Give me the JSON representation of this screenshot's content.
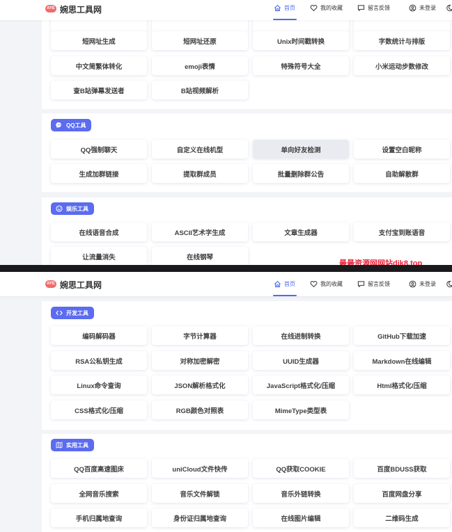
{
  "brand": {
    "logo_text": "AYE",
    "name": "婉思工具网"
  },
  "nav": [
    {
      "label": "首页",
      "icon": "home-icon",
      "active": true
    },
    {
      "label": "我的收藏",
      "icon": "heart-icon",
      "active": false
    },
    {
      "label": "留言反馈",
      "icon": "chat-icon",
      "active": false
    },
    {
      "label": "未登录",
      "icon": "user-icon",
      "active": false
    }
  ],
  "accent_color": "#5b6cf0",
  "screenshot1": {
    "misc_rows": [
      [
        "短网址生成",
        "短网址还原",
        "Unix时间戳转换",
        "字数统计与排版"
      ],
      [
        "中文简繁体转化",
        "emoji表情",
        "特殊符号大全",
        "小米运动步数修改"
      ],
      [
        "查B站弹幕发送者",
        "B站视频解析"
      ]
    ],
    "qq_section": {
      "title": "QQ工具",
      "icon": "chat-bubble-icon",
      "rows": [
        [
          "QQ强制聊天",
          "自定义在线机型",
          "单向好友检测",
          "设置空白昵称"
        ],
        [
          "生成加群链接",
          "提取群成员",
          "批量删除群公告",
          "自助解散群"
        ]
      ]
    },
    "fun_section": {
      "title": "娱乐工具",
      "icon": "smile-icon",
      "rows": [
        [
          "在线语音合成",
          "ASCII艺术字生成",
          "文章生成器",
          "支付宝到账语音"
        ],
        [
          "让流量消失",
          "在线钢琴"
        ]
      ]
    },
    "watermark": "最最资源网网站dik8.top"
  },
  "screenshot2": {
    "dev_section": {
      "title": "开发工具",
      "icon": "code-icon",
      "rows": [
        [
          "编码解码器",
          "字节计算器",
          "在线进制转换",
          "GitHub下载加速"
        ],
        [
          "RSA公私钥生成",
          "对称加密解密",
          "UUID生成器",
          "Markdown在线编辑"
        ],
        [
          "Linux命令查询",
          "JSON解析格式化",
          "JavaScript格式化/压缩",
          "Html格式化/压缩"
        ],
        [
          "CSS格式化/压缩",
          "RGB颜色对照表",
          "MimeType类型表"
        ]
      ]
    },
    "practical_section": {
      "title": "实用工具",
      "icon": "map-icon",
      "rows": [
        [
          "QQ百度高速图床",
          "uniCloud文件快传",
          "QQ获取COOKIE",
          "百度BDUSS获取"
        ],
        [
          "全网音乐搜索",
          "音乐文件解锁",
          "音乐外链转换",
          "百度网盘分享"
        ],
        [
          "手机归属地查询",
          "身份证归属地查询",
          "在线图片编辑",
          "二维码生成"
        ]
      ]
    }
  }
}
